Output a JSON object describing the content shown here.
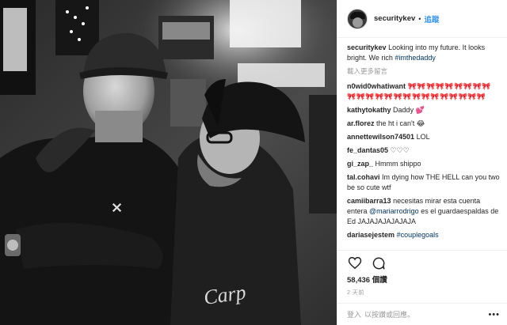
{
  "post": {
    "username": "securitykev",
    "separator": "•",
    "follow_label": "追蹤",
    "caption": {
      "user": "securitykev",
      "text": "Looking into my future. It looks bright. We rich ",
      "hashtag": "#imthedaddy"
    },
    "load_more": "載入更多留言",
    "comments": [
      {
        "user": "n0wid0whatiwant",
        "text": "🎀🎀🎀🎀🎀🎀🎀🎀🎀🎀🎀🎀🎀🎀🎀🎀🎀🎀🎀🎀🎀🎀🎀🎀"
      },
      {
        "user": "kathytokathy",
        "text": "Daddy 💕"
      },
      {
        "user": "ar.florez",
        "text": "the ht i can't 😂"
      },
      {
        "user": "annettewilson74501",
        "text": "LOL"
      },
      {
        "user": "fe_dantas05",
        "text": "♡♡♡"
      },
      {
        "user": "gi_zap_",
        "text": "Hmmm shippo"
      },
      {
        "user": "tal.cohavi",
        "text": "Im dying how THE HELL can you two be so cute wtf"
      },
      {
        "user": "camiibarra13",
        "text_before": "necesitas mirar esta cuenta entera ",
        "mention": "@mariarrodrigo",
        "text_after": " es el guardaespaldas de Ed JAJAJAJAJAJAJA"
      },
      {
        "user": "dariasejestem",
        "hashtag": "#couplegoals"
      }
    ],
    "likes": "58,436 個讚",
    "time": "2 天前",
    "login_prompt": "登入",
    "login_prompt_rest": "以按讚或回應。",
    "more_options": "•••",
    "icons": {
      "avatar": "avatar",
      "like": "heart-icon",
      "comment": "comment-icon",
      "more": "more-options-icon"
    }
  }
}
